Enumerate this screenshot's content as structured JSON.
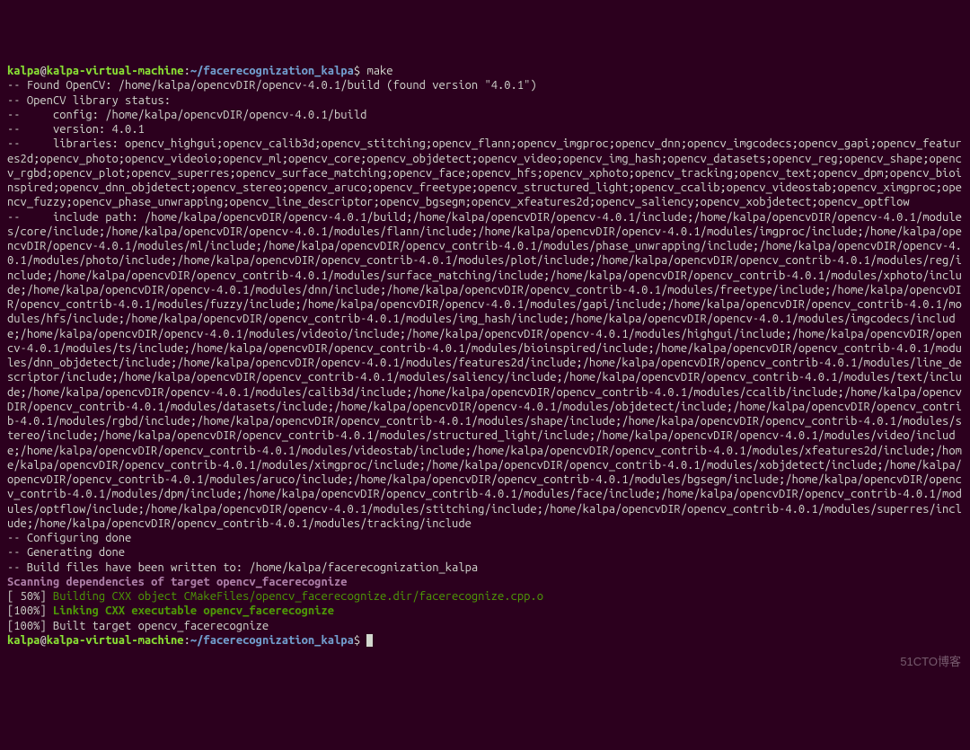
{
  "prompt1": {
    "user": "kalpa",
    "host": "kalpa-virtual-machine",
    "path": "~/facerecognization_kalpa",
    "symbol": "$",
    "command": "make"
  },
  "lines": {
    "l0": "-- Found OpenCV: /home/kalpa/opencvDIR/opencv-4.0.1/build (found version \"4.0.1\")",
    "l1": "-- OpenCV library status:",
    "l2": "--     config: /home/kalpa/opencvDIR/opencv-4.0.1/build",
    "l3": "--     version: 4.0.1",
    "l4": "--     libraries: opencv_highgui;opencv_calib3d;opencv_stitching;opencv_flann;opencv_imgproc;opencv_dnn;opencv_imgcodecs;opencv_gapi;opencv_features2d;opencv_photo;opencv_videoio;opencv_ml;opencv_core;opencv_objdetect;opencv_video;opencv_img_hash;opencv_datasets;opencv_reg;opencv_shape;opencv_rgbd;opencv_plot;opencv_superres;opencv_surface_matching;opencv_face;opencv_hfs;opencv_xphoto;opencv_tracking;opencv_text;opencv_dpm;opencv_bioinspired;opencv_dnn_objdetect;opencv_stereo;opencv_aruco;opencv_freetype;opencv_structured_light;opencv_ccalib;opencv_videostab;opencv_ximgproc;opencv_fuzzy;opencv_phase_unwrapping;opencv_line_descriptor;opencv_bgsegm;opencv_xfeatures2d;opencv_saliency;opencv_xobjdetect;opencv_optflow",
    "l5": "--     include path: /home/kalpa/opencvDIR/opencv-4.0.1/build;/home/kalpa/opencvDIR/opencv-4.0.1/include;/home/kalpa/opencvDIR/opencv-4.0.1/modules/core/include;/home/kalpa/opencvDIR/opencv-4.0.1/modules/flann/include;/home/kalpa/opencvDIR/opencv-4.0.1/modules/imgproc/include;/home/kalpa/opencvDIR/opencv-4.0.1/modules/ml/include;/home/kalpa/opencvDIR/opencv_contrib-4.0.1/modules/phase_unwrapping/include;/home/kalpa/opencvDIR/opencv-4.0.1/modules/photo/include;/home/kalpa/opencvDIR/opencv_contrib-4.0.1/modules/plot/include;/home/kalpa/opencvDIR/opencv_contrib-4.0.1/modules/reg/include;/home/kalpa/opencvDIR/opencv_contrib-4.0.1/modules/surface_matching/include;/home/kalpa/opencvDIR/opencv_contrib-4.0.1/modules/xphoto/include;/home/kalpa/opencvDIR/opencv-4.0.1/modules/dnn/include;/home/kalpa/opencvDIR/opencv_contrib-4.0.1/modules/freetype/include;/home/kalpa/opencvDIR/opencv_contrib-4.0.1/modules/fuzzy/include;/home/kalpa/opencvDIR/opencv-4.0.1/modules/gapi/include;/home/kalpa/opencvDIR/opencv_contrib-4.0.1/modules/hfs/include;/home/kalpa/opencvDIR/opencv_contrib-4.0.1/modules/img_hash/include;/home/kalpa/opencvDIR/opencv-4.0.1/modules/imgcodecs/include;/home/kalpa/opencvDIR/opencv-4.0.1/modules/videoio/include;/home/kalpa/opencvDIR/opencv-4.0.1/modules/highgui/include;/home/kalpa/opencvDIR/opencv-4.0.1/modules/ts/include;/home/kalpa/opencvDIR/opencv_contrib-4.0.1/modules/bioinspired/include;/home/kalpa/opencvDIR/opencv_contrib-4.0.1/modules/dnn_objdetect/include;/home/kalpa/opencvDIR/opencv-4.0.1/modules/features2d/include;/home/kalpa/opencvDIR/opencv_contrib-4.0.1/modules/line_descriptor/include;/home/kalpa/opencvDIR/opencv_contrib-4.0.1/modules/saliency/include;/home/kalpa/opencvDIR/opencv_contrib-4.0.1/modules/text/include;/home/kalpa/opencvDIR/opencv-4.0.1/modules/calib3d/include;/home/kalpa/opencvDIR/opencv_contrib-4.0.1/modules/ccalib/include;/home/kalpa/opencvDIR/opencv_contrib-4.0.1/modules/datasets/include;/home/kalpa/opencvDIR/opencv-4.0.1/modules/objdetect/include;/home/kalpa/opencvDIR/opencv_contrib-4.0.1/modules/rgbd/include;/home/kalpa/opencvDIR/opencv_contrib-4.0.1/modules/shape/include;/home/kalpa/opencvDIR/opencv_contrib-4.0.1/modules/stereo/include;/home/kalpa/opencvDIR/opencv_contrib-4.0.1/modules/structured_light/include;/home/kalpa/opencvDIR/opencv-4.0.1/modules/video/include;/home/kalpa/opencvDIR/opencv_contrib-4.0.1/modules/videostab/include;/home/kalpa/opencvDIR/opencv_contrib-4.0.1/modules/xfeatures2d/include;/home/kalpa/opencvDIR/opencv_contrib-4.0.1/modules/ximgproc/include;/home/kalpa/opencvDIR/opencv_contrib-4.0.1/modules/xobjdetect/include;/home/kalpa/opencvDIR/opencv_contrib-4.0.1/modules/aruco/include;/home/kalpa/opencvDIR/opencv_contrib-4.0.1/modules/bgsegm/include;/home/kalpa/opencvDIR/opencv_contrib-4.0.1/modules/dpm/include;/home/kalpa/opencvDIR/opencv_contrib-4.0.1/modules/face/include;/home/kalpa/opencvDIR/opencv_contrib-4.0.1/modules/optflow/include;/home/kalpa/opencvDIR/opencv-4.0.1/modules/stitching/include;/home/kalpa/opencvDIR/opencv_contrib-4.0.1/modules/superres/include;/home/kalpa/opencvDIR/opencv_contrib-4.0.1/modules/tracking/include",
    "l6": "-- Configuring done",
    "l7": "-- Generating done",
    "l8": "-- Build files have been written to: /home/kalpa/facerecognization_kalpa",
    "scan": "Scanning dependencies of target opencv_facerecognize",
    "p50a": "[ 50%] ",
    "p50b": "Building CXX object CMakeFiles/opencv_facerecognize.dir/facerecognize.cpp.o",
    "p100a": "[100%] ",
    "p100b": "Linking CXX executable opencv_facerecognize",
    "p100c": "[100%] Built target opencv_facerecognize"
  },
  "prompt2": {
    "user": "kalpa",
    "host": "kalpa-virtual-machine",
    "path": "~/facerecognization_kalpa",
    "symbol": "$"
  },
  "watermark": "51CTO博客"
}
